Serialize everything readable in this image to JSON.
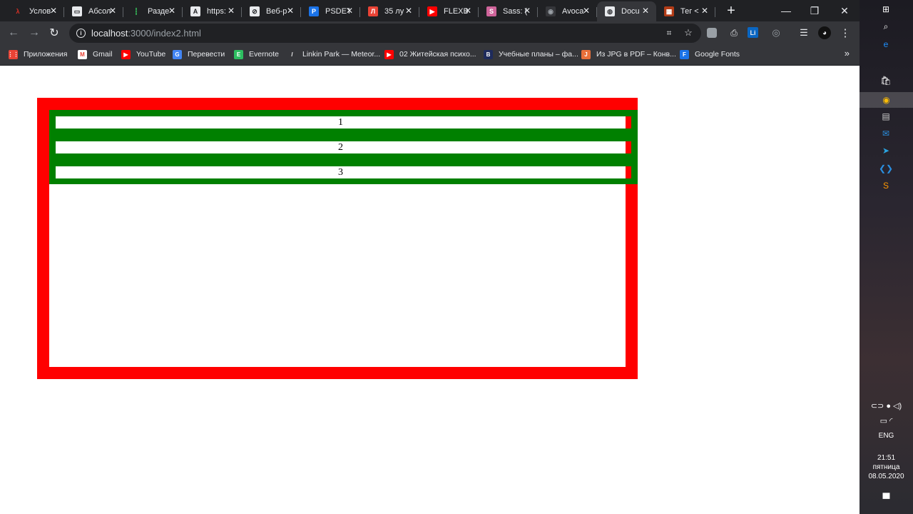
{
  "browser": {
    "tabs": [
      {
        "title": "Услов",
        "favicon_color": "#202124",
        "favicon_glyph": "λ",
        "favicon_text_color": "#d93025"
      },
      {
        "title": "Абсол",
        "favicon_color": "#e8eaed",
        "favicon_glyph": "▭",
        "favicon_text_color": "#202124"
      },
      {
        "title": "Разде",
        "favicon_color": "#202124",
        "favicon_glyph": "┇",
        "favicon_text_color": "#34a853"
      },
      {
        "title": "https:",
        "favicon_color": "#e8eaed",
        "favicon_glyph": "A",
        "favicon_text_color": "#202124"
      },
      {
        "title": "Веб-р",
        "favicon_color": "#e8eaed",
        "favicon_glyph": "⊘",
        "favicon_text_color": "#202124"
      },
      {
        "title": "PSDET",
        "favicon_color": "#1a73e8",
        "favicon_glyph": "P",
        "favicon_text_color": "#ffffff"
      },
      {
        "title": "35 лу",
        "favicon_color": "#ea4335",
        "favicon_glyph": "Л",
        "favicon_text_color": "#ffffff"
      },
      {
        "title": "FLEXB",
        "favicon_color": "#ff0000",
        "favicon_glyph": "▶",
        "favicon_text_color": "#ffffff"
      },
      {
        "title": "Sass: (",
        "favicon_color": "#cf649a",
        "favicon_glyph": "S",
        "favicon_text_color": "#ffffff"
      },
      {
        "title": "Avoca",
        "favicon_color": "#35363a",
        "favicon_glyph": "◉",
        "favicon_text_color": "#9aa0a6"
      },
      {
        "title": "Docu",
        "favicon_color": "#e8eaed",
        "favicon_glyph": "◍",
        "favicon_text_color": "#35363a",
        "active": true
      },
      {
        "title": "Тег <",
        "favicon_color": "#b23c17",
        "favicon_glyph": "▦",
        "favicon_text_color": "#ffffff"
      }
    ],
    "close_glyph": "✕",
    "new_tab_glyph": "+",
    "window_controls": {
      "minimize": "—",
      "maximize": "❐",
      "close": "✕"
    },
    "nav": {
      "back": "←",
      "forward": "→",
      "reload": "↻"
    },
    "url": {
      "host": "localhost",
      "rest": ":3000/index2.html"
    },
    "bookmarks": [
      {
        "label": "Приложения",
        "icon": "apps-icon",
        "color": "#ea4335",
        "glyph": "⋮⋮"
      },
      {
        "label": "Gmail",
        "icon": "gmail-icon",
        "color": "#ffffff",
        "glyph": "M",
        "glyph_color": "#ea4335"
      },
      {
        "label": "YouTube",
        "icon": "youtube-icon",
        "color": "#ff0000",
        "glyph": "▶"
      },
      {
        "label": "Перевести",
        "icon": "translate-icon",
        "color": "#4285f4",
        "glyph": "G"
      },
      {
        "label": "Evernote",
        "icon": "evernote-icon",
        "color": "#2dbe60",
        "glyph": "E"
      },
      {
        "label": "Linkin Park — Meteor...",
        "icon": "linkin-park-icon",
        "color": "#35363a",
        "glyph": "/"
      },
      {
        "label": "02 Житейская психо...",
        "icon": "youtube-icon",
        "color": "#ff0000",
        "glyph": "▶"
      },
      {
        "label": "Учебные планы – фа...",
        "icon": "hse-icon",
        "color": "#1e2b5c",
        "glyph": "В"
      },
      {
        "label": "Из JPG в PDF – Конв...",
        "icon": "jpg-pdf-icon",
        "color": "#e8703a",
        "glyph": "J"
      },
      {
        "label": "Google Fonts",
        "icon": "google-fonts-icon",
        "color": "#1a73e8",
        "glyph": "F"
      }
    ],
    "bookmarks_more": "»"
  },
  "content": {
    "items": [
      "1",
      "2",
      "3"
    ],
    "colors": {
      "outer": "#ff0000",
      "green": "#008000",
      "item": "#ffffff"
    }
  },
  "taskbar": {
    "apps": [
      {
        "name": "windows-start-icon",
        "glyph": "⊞",
        "color": "#ffffff"
      },
      {
        "name": "search-icon",
        "glyph": "⌕",
        "color": "#ffffff"
      },
      {
        "name": "edge-icon",
        "glyph": "e",
        "color": "#1e90ff"
      },
      {
        "name": "store-icon",
        "glyph": "🛍",
        "color": "#ffffff"
      },
      {
        "name": "chrome-icon",
        "glyph": "◉",
        "color": "#fbbc05"
      },
      {
        "name": "photos-icon",
        "glyph": "▤",
        "color": "#cccccc"
      },
      {
        "name": "mail-icon",
        "glyph": "✉",
        "color": "#2a8fe0"
      },
      {
        "name": "telegram-icon",
        "glyph": "➤",
        "color": "#2aa3e0"
      },
      {
        "name": "vscode-icon",
        "glyph": "❮❯",
        "color": "#2a8fe0"
      },
      {
        "name": "sublime-icon",
        "glyph": "S",
        "color": "#ff9800"
      }
    ],
    "language": "ENG",
    "time": "21:51",
    "weekday": "пятница",
    "date": "08.05.2020"
  }
}
